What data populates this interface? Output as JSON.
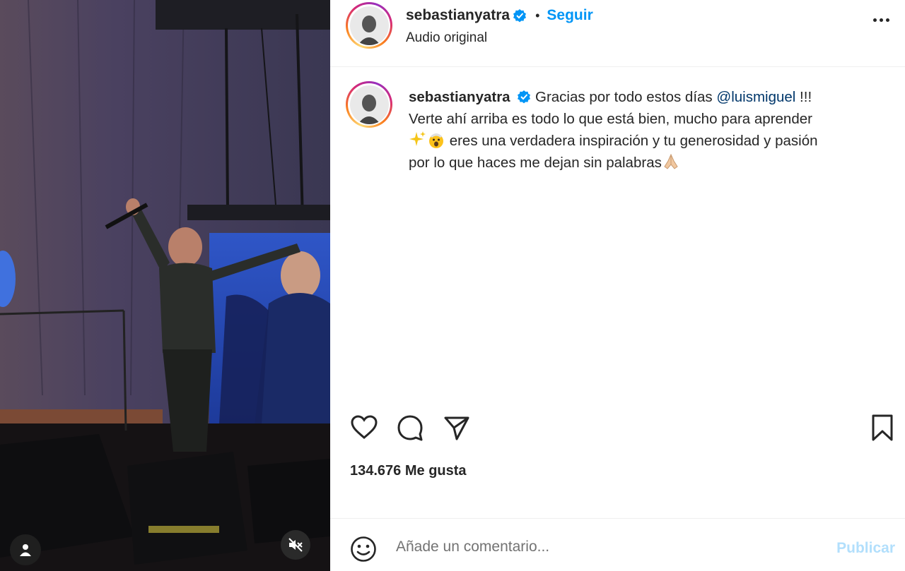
{
  "post": {
    "username": "sebastianyatra",
    "separator": "•",
    "follow_label": "Seguir",
    "audio_label": "Audio original",
    "caption": {
      "line1_text": "Gracias por todo estos días ",
      "mention": "@luismiguel",
      "line1_end": " !!!",
      "line2": "Verte ahí arriba es todo lo que está bien, mucho para aprender",
      "line3": " eres una verdadera inspiración y tu generosidad y pasión",
      "line4": "por lo que haces me dejan sin palabras"
    },
    "likes_text": "134.676 Me gusta"
  },
  "comment": {
    "placeholder": "Añade un comentario...",
    "publish_label": "Publicar"
  },
  "colors": {
    "link_blue": "#0095f6",
    "mention": "#00376b",
    "publish_disabled": "#b2dffc",
    "verified": "#0095f6"
  },
  "icons": [
    "user-tag-icon",
    "mute-icon",
    "more-options-icon",
    "heart-icon",
    "comment-icon",
    "share-icon",
    "bookmark-icon",
    "emoji-icon",
    "verified-badge-icon"
  ]
}
